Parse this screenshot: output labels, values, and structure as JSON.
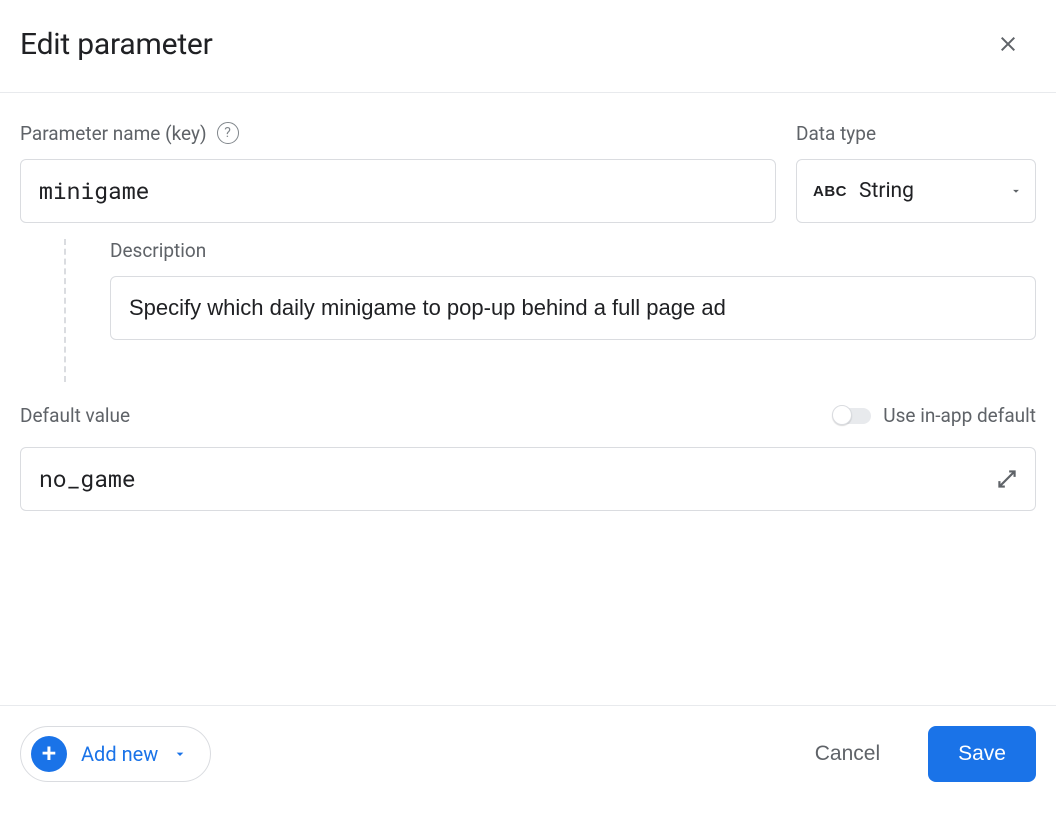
{
  "header": {
    "title": "Edit parameter"
  },
  "key_field": {
    "label": "Parameter name (key)",
    "value": "minigame"
  },
  "type_field": {
    "label": "Data type",
    "selected": "String",
    "icon_text": "ABC"
  },
  "description": {
    "label": "Description",
    "value": "Specify which daily minigame to pop-up behind a full page ad"
  },
  "default_value": {
    "label": "Default value",
    "toggle_label": "Use in-app default",
    "toggle_on": false,
    "value": "no_game"
  },
  "footer": {
    "add_new": "Add new",
    "cancel": "Cancel",
    "save": "Save"
  }
}
